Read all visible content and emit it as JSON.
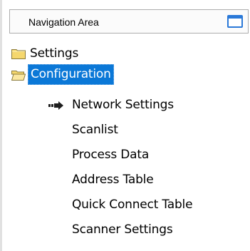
{
  "header": {
    "title": "Navigation Area"
  },
  "tree": {
    "items": [
      {
        "label": "Settings",
        "icon": "folder-closed-icon",
        "selected": false
      },
      {
        "label": "Configuration",
        "icon": "folder-open-icon",
        "selected": true
      },
      {
        "label": "Network Settings",
        "icon": "arrow-right-icon",
        "active": true
      },
      {
        "label": "Scanlist"
      },
      {
        "label": "Process Data"
      },
      {
        "label": "Address Table"
      },
      {
        "label": "Quick Connect Table"
      },
      {
        "label": "Scanner Settings"
      }
    ]
  },
  "colors": {
    "selection": "#0b78d7",
    "folder": "#f5d76e",
    "restore_icon": "#2b79d8"
  }
}
